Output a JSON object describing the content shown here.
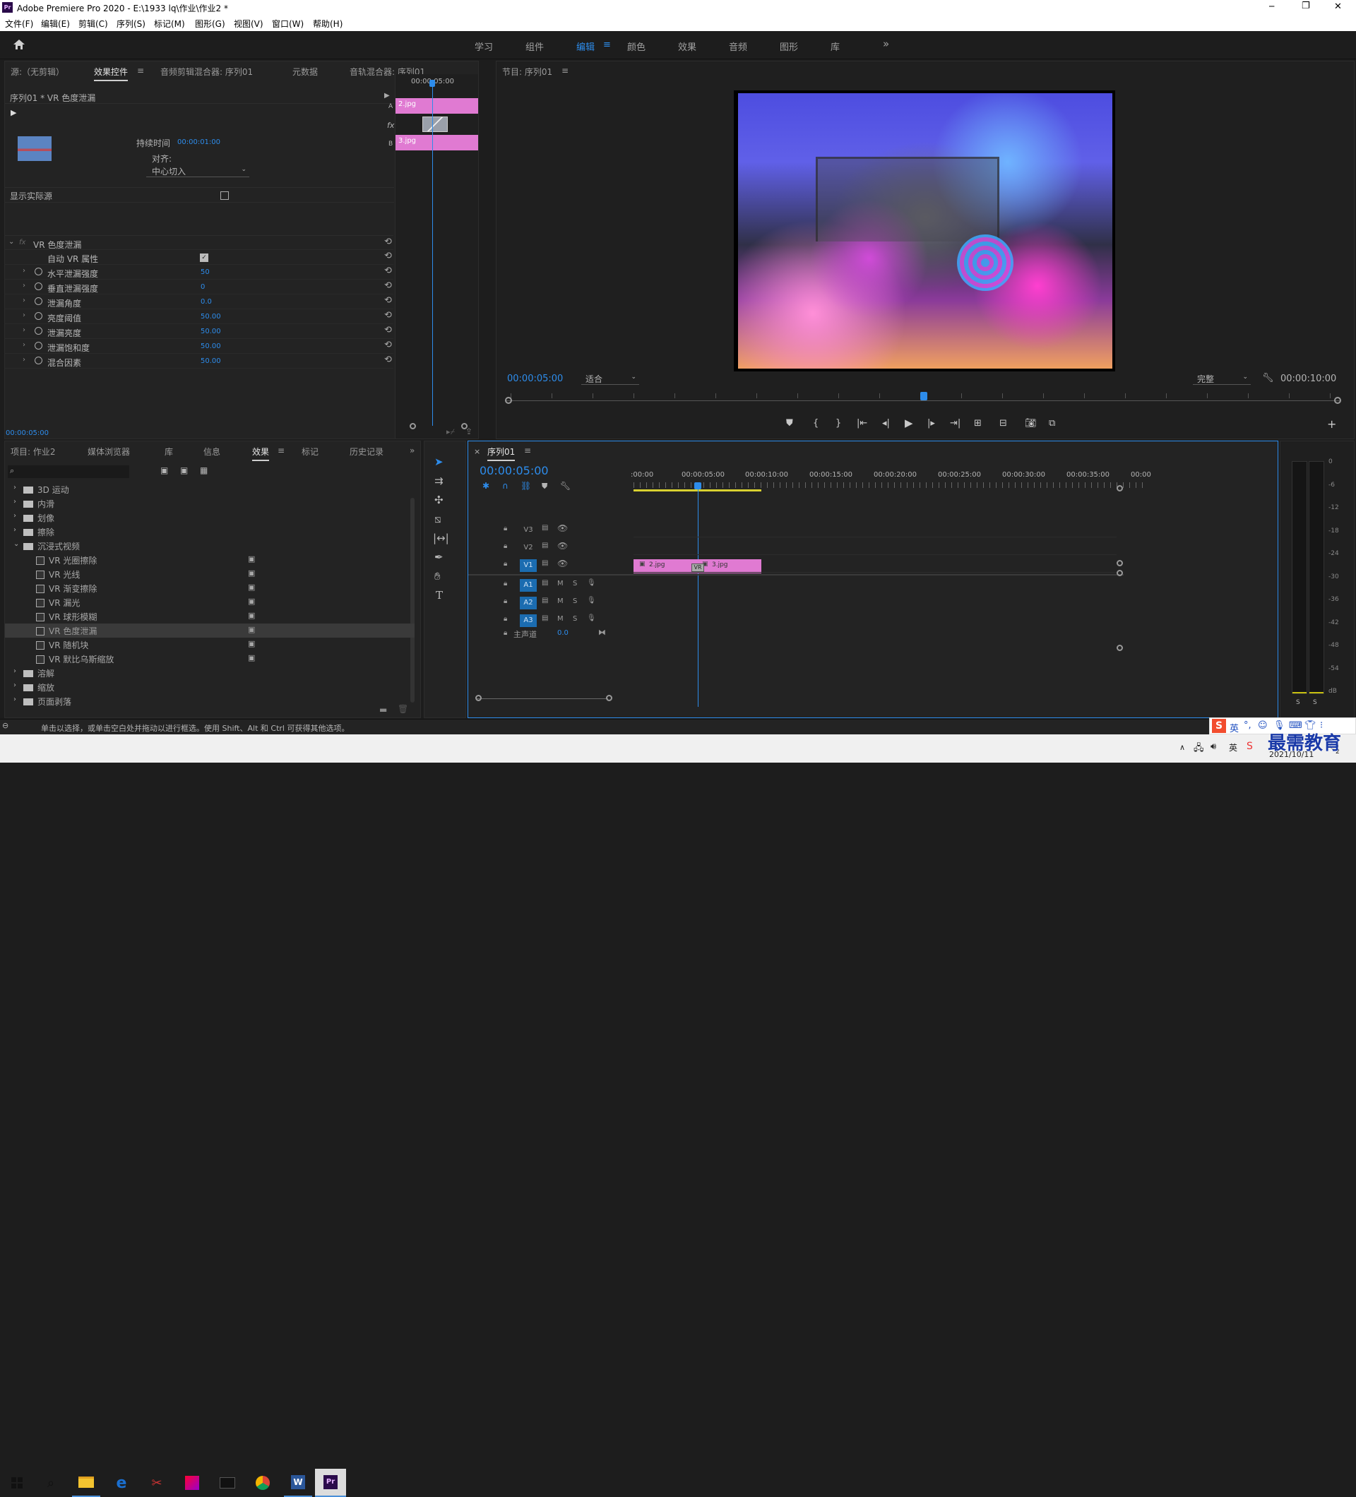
{
  "window": {
    "title": "Adobe Premiere Pro 2020 - E:\\1933 lq\\作业\\作业2 *",
    "app_icon": "Pr",
    "minimize": "─",
    "restore": "❐",
    "close": "✕"
  },
  "menu": [
    "文件(F)",
    "编辑(E)",
    "剪辑(C)",
    "序列(S)",
    "标记(M)",
    "图形(G)",
    "视图(V)",
    "窗口(W)",
    "帮助(H)"
  ],
  "workspaces": [
    "学习",
    "组件",
    "编辑",
    "颜色",
    "效果",
    "音频",
    "图形",
    "库"
  ],
  "workspace_menu": "≡",
  "workspace_more": "»",
  "source_panel": {
    "tabs": [
      "源:（无剪辑）",
      "效果控件",
      "音频剪辑混合器: 序列01",
      "元数据",
      "音轨混合器: 序列01"
    ],
    "tab_menu": "≡",
    "header": "序列01 * VR 色度泄漏",
    "duration_label": "持续时间",
    "duration_value": "00:00:01:00",
    "align_label": "对齐:",
    "align_value": "中心切入",
    "show_source": "显示实际源",
    "mini_timecode": "00:00:05:00",
    "clip_a": "2.jpg",
    "clip_b": "3.jpg",
    "track_a": "A",
    "track_b": "B",
    "fx_mark": "fx",
    "effect_name": "VR 色度泄漏",
    "auto_vr": "自动 VR 属性",
    "params": [
      {
        "name": "水平泄漏强度",
        "value": "50"
      },
      {
        "name": "垂直泄漏强度",
        "value": "0"
      },
      {
        "name": "泄漏角度",
        "value": "0.0"
      },
      {
        "name": "亮度阈值",
        "value": "50.00"
      },
      {
        "name": "泄漏亮度",
        "value": "50.00"
      },
      {
        "name": "泄漏饱和度",
        "value": "50.00"
      },
      {
        "name": "混合因素",
        "value": "50.00"
      }
    ],
    "bottom_timecode": "00:00:05:00"
  },
  "program": {
    "title": "节目: 序列01",
    "menu": "≡",
    "timecode": "00:00:05:00",
    "fit": "适合",
    "quality": "完整",
    "duration": "00:00:10:00"
  },
  "project_panel": {
    "tabs": [
      "项目: 作业2",
      "媒体浏览器",
      "库",
      "信息",
      "效果",
      "标记",
      "历史记录"
    ],
    "more": "»",
    "folders_top": [
      "3D 运动",
      "内滑",
      "划像",
      "擦除"
    ],
    "open_folder": "沉浸式视频",
    "items": [
      "VR 光圈擦除",
      "VR 光线",
      "VR 渐变擦除",
      "VR 漏光",
      "VR 球形模糊",
      "VR 色度泄漏",
      "VR 随机块",
      "VR 默比乌斯缩放"
    ],
    "selected": "VR 色度泄漏",
    "folders_bottom": [
      "溶解",
      "缩放",
      "页面剥落"
    ]
  },
  "timeline": {
    "close": "×",
    "tab": "序列01",
    "menu": "≡",
    "timecode": "00:00:05:00",
    "ruler": [
      ":00:00",
      "00:00:05:00",
      "00:00:10:00",
      "00:00:15:00",
      "00:00:20:00",
      "00:00:25:00",
      "00:00:30:00",
      "00:00:35:00",
      "00:00"
    ],
    "video_tracks": [
      "V3",
      "V2",
      "V1"
    ],
    "audio_tracks": [
      "A1",
      "A2",
      "A3"
    ],
    "mute": "M",
    "solo": "S",
    "master": "主声道",
    "master_value": "0.0",
    "clip1": "2.jpg",
    "clip2": "3.jpg",
    "transition": "VR"
  },
  "meter": {
    "labels": [
      "0",
      "-6",
      "-12",
      "-18",
      "-24",
      "-30",
      "-36",
      "-42",
      "-48",
      "-54",
      "dB"
    ],
    "solo": "S"
  },
  "status_text": "单击以选择，或单击空白处并拖动以进行框选。使用 Shift、Alt 和 Ctrl 可获得其他选项。",
  "taskbar": {
    "ime": "英",
    "date": "2021/10/11",
    "watermark": "最需教育",
    "notify": "2"
  }
}
